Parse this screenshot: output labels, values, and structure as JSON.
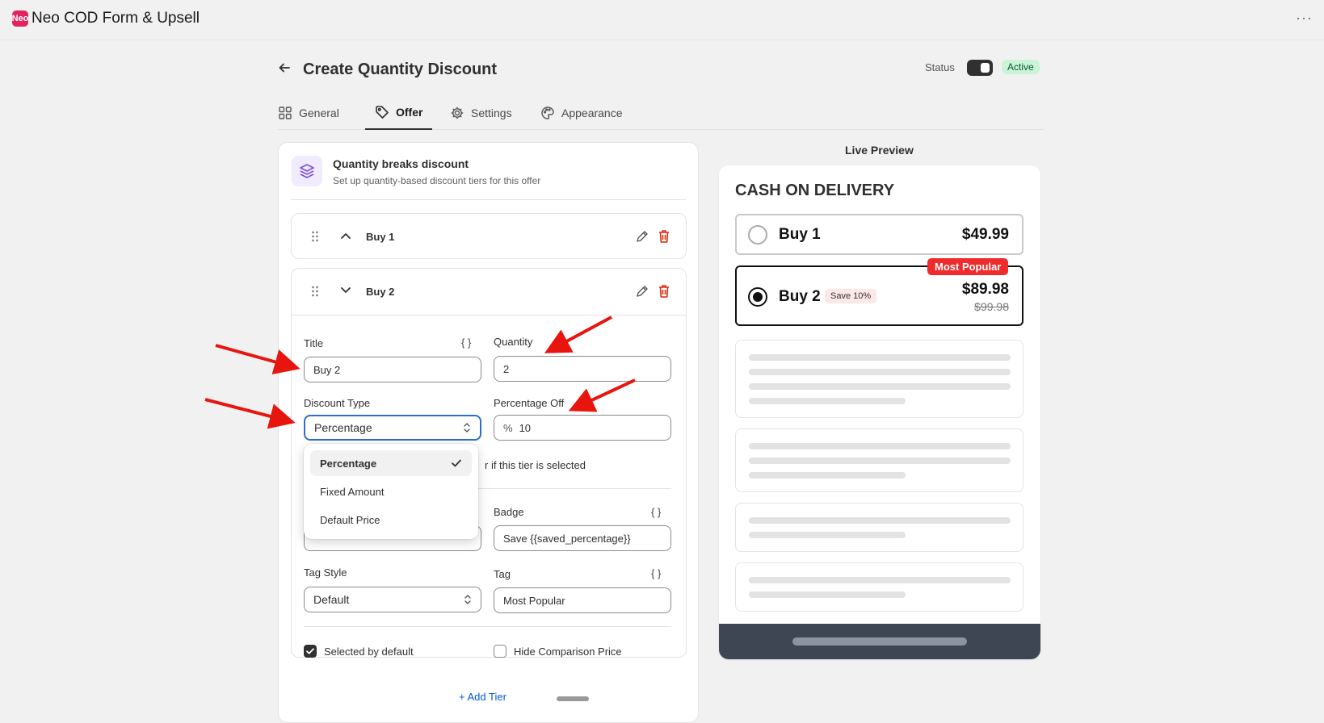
{
  "app": {
    "logo_text": "Neo",
    "name": "Neo COD Form & Upsell",
    "more_label": "···"
  },
  "header": {
    "title": "Create Quantity Discount",
    "status_label": "Status",
    "status_value": "Active",
    "status_on": true
  },
  "tabs": [
    {
      "label": "General",
      "icon": "grid-icon"
    },
    {
      "label": "Offer",
      "icon": "tag-icon",
      "active": true
    },
    {
      "label": "Settings",
      "icon": "gear-icon"
    },
    {
      "label": "Appearance",
      "icon": "palette-icon"
    }
  ],
  "section": {
    "title": "Quantity breaks discount",
    "subtitle": "Set up quantity-based discount tiers for this offer"
  },
  "tiers": [
    {
      "title": "Buy 1",
      "expanded": false
    },
    {
      "title": "Buy 2",
      "expanded": true
    }
  ],
  "form": {
    "title_label": "Title",
    "title_value": "Buy 2",
    "quantity_label": "Quantity",
    "quantity_value": "2",
    "discount_type_label": "Discount Type",
    "discount_type_value": "Percentage",
    "percentage_off_label": "Percentage Off",
    "percentage_prefix": "%",
    "percentage_value": "10",
    "partial_text": "r if this tier is selected",
    "badge_label": "Badge",
    "badge_value": "Save {{saved_percentage}}",
    "tag_style_label": "Tag Style",
    "tag_style_value": "Default",
    "tag_label": "Tag",
    "tag_value": "Most Popular",
    "selected_default_label": "Selected by default",
    "selected_default_checked": true,
    "hide_comparison_label": "Hide Comparison Price",
    "hide_comparison_checked": false,
    "braces": "{ }"
  },
  "dropdown": {
    "options": [
      "Percentage",
      "Fixed Amount",
      "Default Price"
    ],
    "selected": "Percentage"
  },
  "add_tier_label": "+ Add Tier",
  "preview": {
    "label": "Live Preview",
    "heading": "CASH ON DELIVERY",
    "options": [
      {
        "title": "Buy 1",
        "price": "$49.99",
        "selected": false
      },
      {
        "title": "Buy 2",
        "badge": "Save 10%",
        "tag": "Most Popular",
        "price": "$89.98",
        "compare_price": "$99.98",
        "selected": true
      }
    ]
  },
  "colors": {
    "accent": "#2c6ecb",
    "danger": "#d72c0d",
    "tag_bg": "#ef2b2b",
    "active_badge_bg": "#c9f5d6",
    "annotation_arrow": "#e8140e"
  }
}
